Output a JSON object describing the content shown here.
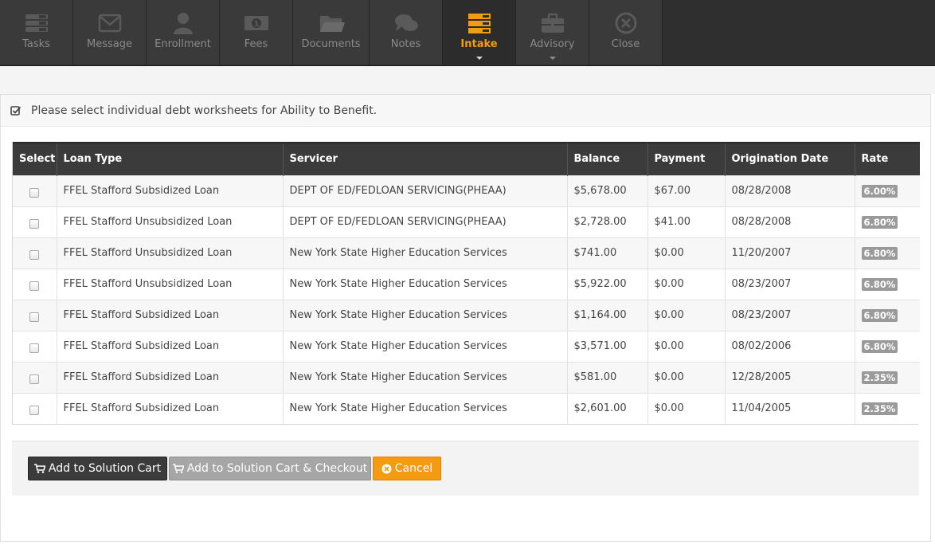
{
  "toolbar": {
    "items": [
      {
        "label": "Tasks",
        "icon": "tasks-icon",
        "active": false,
        "has_caret": false
      },
      {
        "label": "Message",
        "icon": "envelope-icon",
        "active": false,
        "has_caret": false
      },
      {
        "label": "Enrollment",
        "icon": "user-icon",
        "active": false,
        "has_caret": false
      },
      {
        "label": "Fees",
        "icon": "money-icon",
        "active": false,
        "has_caret": false
      },
      {
        "label": "Documents",
        "icon": "folder-icon",
        "active": false,
        "has_caret": false
      },
      {
        "label": "Notes",
        "icon": "comments-icon",
        "active": false,
        "has_caret": false
      },
      {
        "label": "Intake",
        "icon": "list-icon",
        "active": true,
        "has_caret": true
      },
      {
        "label": "Advisory",
        "icon": "briefcase-icon",
        "active": false,
        "has_caret": true
      },
      {
        "label": "Close",
        "icon": "close-circle-icon",
        "active": false,
        "has_caret": false
      }
    ]
  },
  "panel": {
    "title": "Please select individual debt worksheets for Ability to Benefit."
  },
  "table": {
    "columns": [
      "Select",
      "Loan Type",
      "Servicer",
      "Balance",
      "Payment",
      "Origination Date",
      "Rate"
    ],
    "rows": [
      {
        "loan_type": "FFEL Stafford Subsidized Loan",
        "servicer": "DEPT OF ED/FEDLOAN SERVICING(PHEAA)",
        "balance": "$5,678.00",
        "payment": "$67.00",
        "origination": "08/28/2008",
        "rate": "6.00%"
      },
      {
        "loan_type": "FFEL Stafford Unsubsidized Loan",
        "servicer": "DEPT OF ED/FEDLOAN SERVICING(PHEAA)",
        "balance": "$2,728.00",
        "payment": "$41.00",
        "origination": "08/28/2008",
        "rate": "6.80%"
      },
      {
        "loan_type": "FFEL Stafford Unsubsidized Loan",
        "servicer": "New York State Higher Education Services",
        "balance": "$741.00",
        "payment": "$0.00",
        "origination": "11/20/2007",
        "rate": "6.80%"
      },
      {
        "loan_type": "FFEL Stafford Unsubsidized Loan",
        "servicer": "New York State Higher Education Services",
        "balance": "$5,922.00",
        "payment": "$0.00",
        "origination": "08/23/2007",
        "rate": "6.80%"
      },
      {
        "loan_type": "FFEL Stafford Subsidized Loan",
        "servicer": "New York State Higher Education Services",
        "balance": "$1,164.00",
        "payment": "$0.00",
        "origination": "08/23/2007",
        "rate": "6.80%"
      },
      {
        "loan_type": "FFEL Stafford Subsidized Loan",
        "servicer": "New York State Higher Education Services",
        "balance": "$3,571.00",
        "payment": "$0.00",
        "origination": "08/02/2006",
        "rate": "6.80%"
      },
      {
        "loan_type": "FFEL Stafford Subsidized Loan",
        "servicer": "New York State Higher Education Services",
        "balance": "$581.00",
        "payment": "$0.00",
        "origination": "12/28/2005",
        "rate": "2.35%"
      },
      {
        "loan_type": "FFEL Stafford Subsidized Loan",
        "servicer": "New York State Higher Education Services",
        "balance": "$2,601.00",
        "payment": "$0.00",
        "origination": "11/04/2005",
        "rate": "2.35%"
      }
    ]
  },
  "actions": {
    "add_label": "Add to Solution Cart",
    "add_checkout_label": "Add to Solution Cart & Checkout",
    "cancel_label": "Cancel"
  },
  "colors": {
    "accent": "#f39c12",
    "toolbar_bg": "#3a3a3a",
    "header_bg": "#3b3b3b",
    "rate_badge": "#9a9a9a"
  }
}
